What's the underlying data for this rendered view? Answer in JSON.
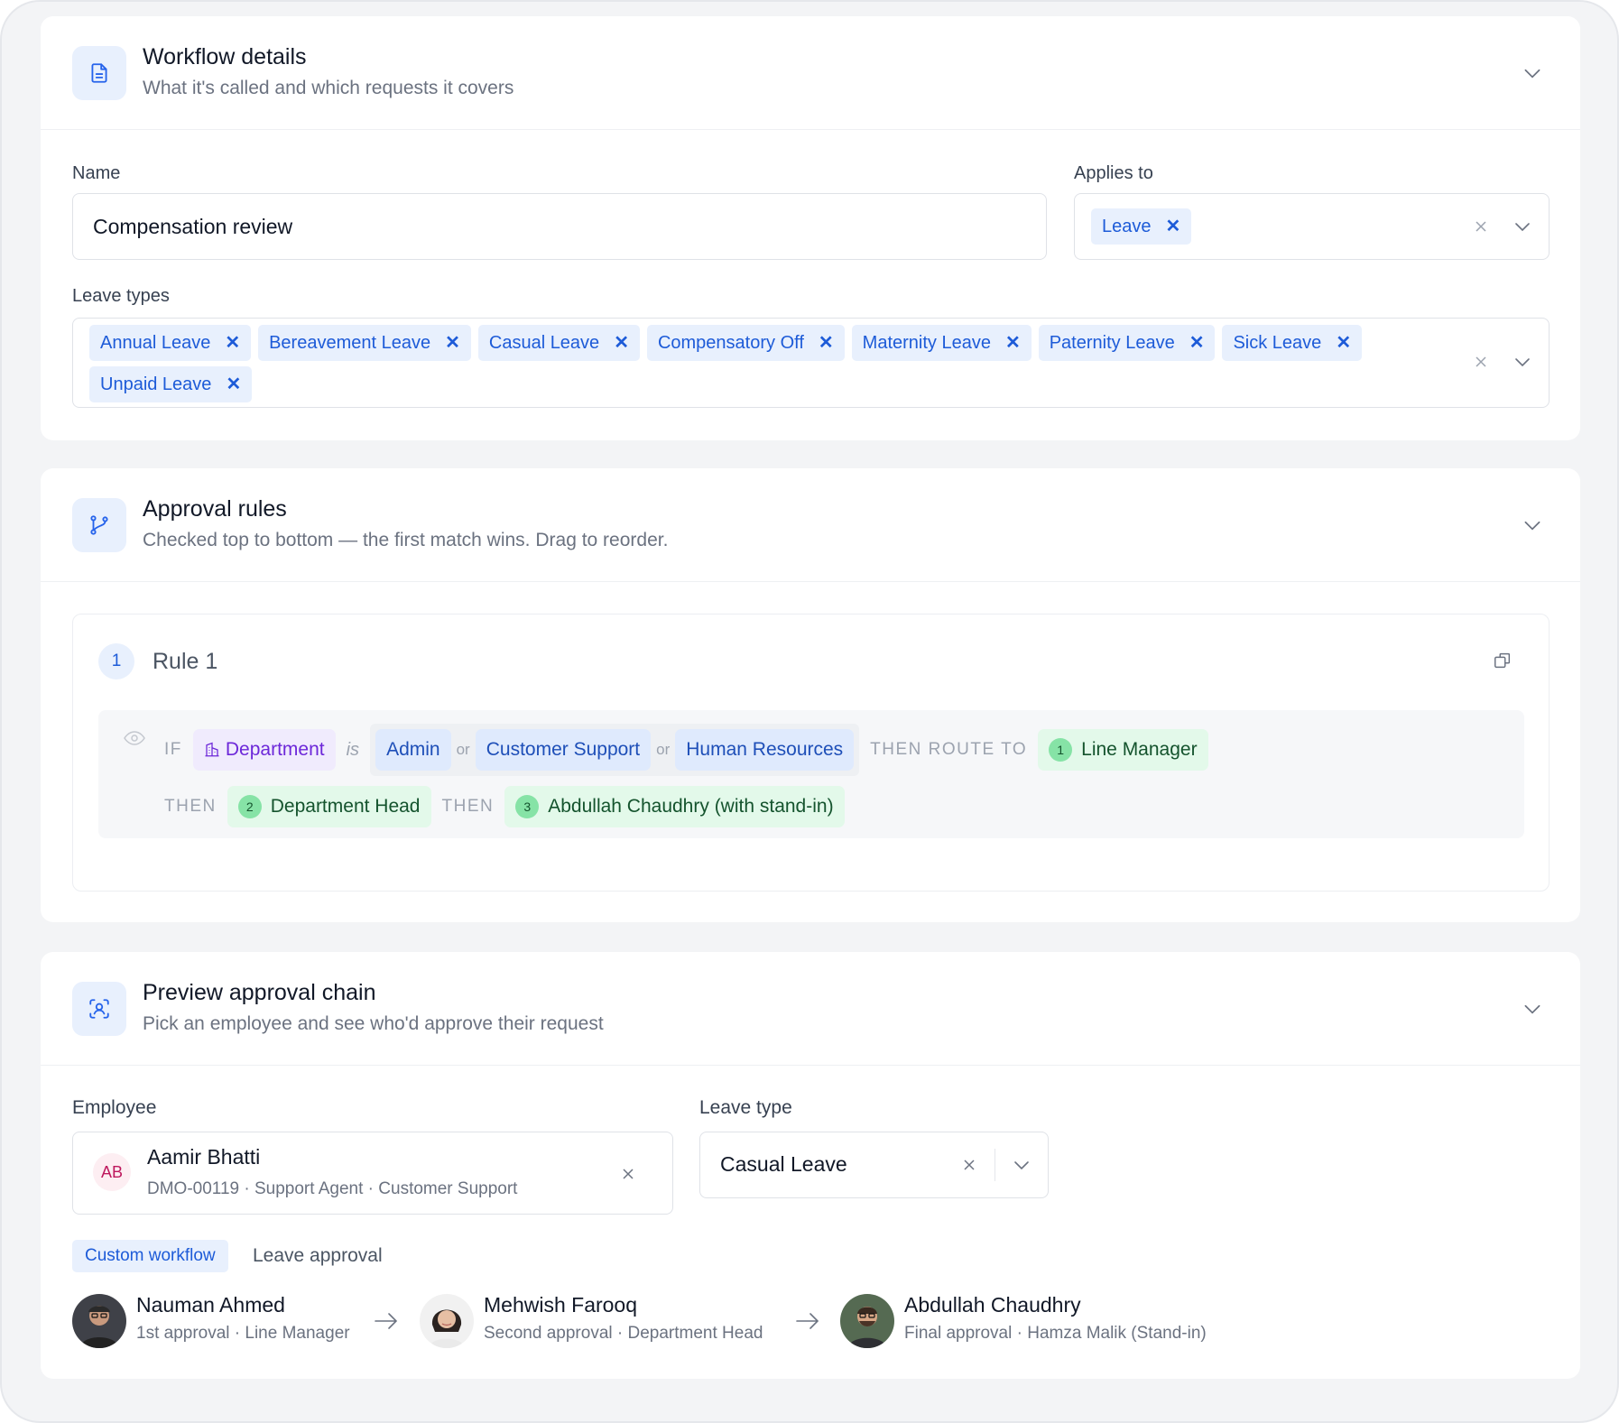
{
  "workflow_details": {
    "title": "Workflow details",
    "subtitle": "What it's called and which requests it covers",
    "name_label": "Name",
    "name_value": "Compensation review",
    "applies_to_label": "Applies to",
    "applies_to_tags": [
      "Leave"
    ],
    "leave_types_label": "Leave types",
    "leave_types": [
      "Annual Leave",
      "Bereavement Leave",
      "Casual Leave",
      "Compensatory Off",
      "Maternity Leave",
      "Paternity Leave",
      "Sick Leave",
      "Unpaid Leave"
    ]
  },
  "approval_rules": {
    "title": "Approval rules",
    "subtitle": "Checked top to bottom — the first match wins. Drag to reorder.",
    "rule": {
      "number": "1",
      "name": "Rule 1",
      "if_keyword": "IF",
      "field": "Department",
      "operator": "is",
      "values": [
        "Admin",
        "Customer Support",
        "Human Resources"
      ],
      "or_keyword": "or",
      "then_route_keyword": "THEN ROUTE TO",
      "then_keyword": "THEN",
      "steps": [
        {
          "num": "1",
          "label": "Line Manager"
        },
        {
          "num": "2",
          "label": "Department Head"
        },
        {
          "num": "3",
          "label": "Abdullah Chaudhry (with stand-in)"
        }
      ]
    }
  },
  "preview": {
    "title": "Preview approval chain",
    "subtitle": "Pick an employee and see who'd approve their request",
    "employee_label": "Employee",
    "employee": {
      "initials": "AB",
      "name": "Aamir Bhatti",
      "meta": "DMO-00119 · Support Agent · Customer Support"
    },
    "leave_type_label": "Leave type",
    "leave_type_value": "Casual Leave",
    "badge": "Custom workflow",
    "workflow_name": "Leave approval",
    "chain": [
      {
        "name": "Nauman Ahmed",
        "role": "1st approval · Line Manager"
      },
      {
        "name": "Mehwish Farooq",
        "role": "Second approval · Department Head"
      },
      {
        "name": "Abdullah Chaudhry",
        "role": "Final approval · Hamza Malik (Stand-in)"
      }
    ]
  },
  "colors": {
    "accent": "#1d5bd8",
    "tag_bg": "#e8f0fd",
    "route_bg": "#e3f9ea",
    "dept_bg": "#f0ebfd"
  }
}
